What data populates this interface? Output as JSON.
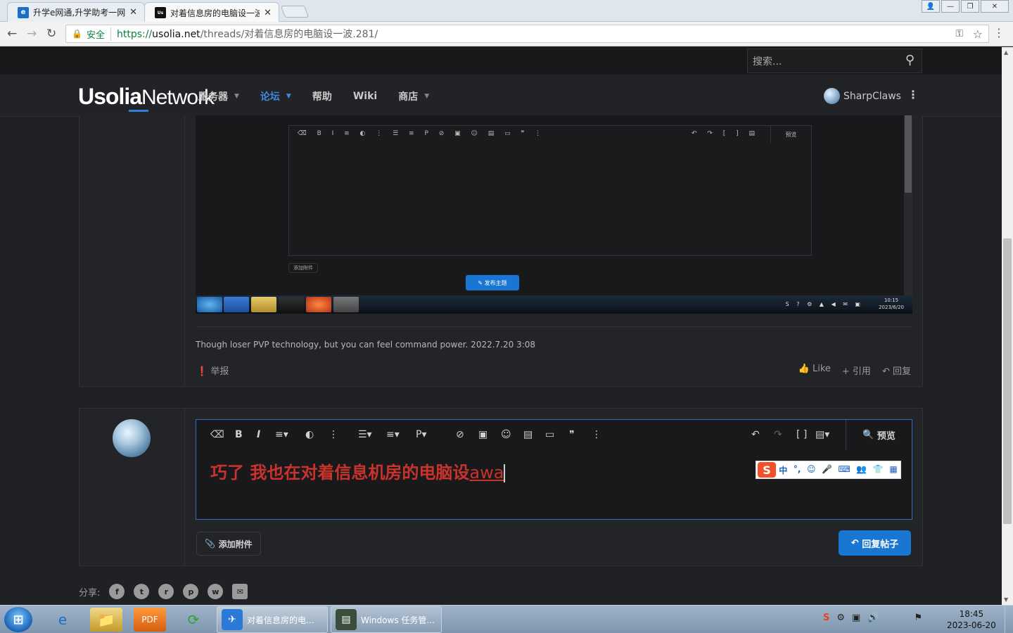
{
  "browser": {
    "tabs": [
      {
        "title": "升学e网通,升学助考一网",
        "active": false
      },
      {
        "title": "对着信息房的电脑设一波",
        "active": true
      }
    ],
    "secure_label": "安全",
    "url_prefix": "https://",
    "url_host": "usolia.net",
    "url_path": "/threads/对着信息房的电脑设一波.281/"
  },
  "site": {
    "search_placeholder": "搜索...",
    "logo_bold": "Usolia",
    "logo_light": "Network",
    "nav": [
      {
        "label": "服务器",
        "caret": true,
        "active": false
      },
      {
        "label": "论坛",
        "caret": true,
        "active": true
      },
      {
        "label": "帮助",
        "caret": false,
        "active": false
      },
      {
        "label": "Wiki",
        "caret": false,
        "active": false
      },
      {
        "label": "商店",
        "caret": true,
        "active": false
      }
    ],
    "username": "SharpClaws"
  },
  "post": {
    "embedded_screenshot": {
      "attach_label": "添加附件",
      "post_button": "发布主题",
      "preview_label": "预览",
      "time": "10:15",
      "date": "2023/6/20"
    },
    "signature": "Though loser PVP technology, but you can feel command power. 2022.7.20 3:08",
    "report_label": "举报",
    "like_label": "Like",
    "quote_label": "+ 引用",
    "reply_label": "回复"
  },
  "reply_editor": {
    "preview_label": "预览",
    "typed_text": "巧了 我也在对着信息机房的电脑设",
    "typed_text_tail": "awa",
    "ime_chars": [
      "中",
      "°,",
      "☺",
      "🎤",
      "⌨",
      "👥",
      "👕",
      "▦"
    ],
    "attach_label": "添加附件",
    "submit_label": "回复帖子"
  },
  "share": {
    "label": "分享:",
    "icons": [
      "facebook-icon",
      "twitter-icon",
      "reddit-icon",
      "pinterest-icon",
      "whatsapp-icon",
      "email-icon"
    ]
  },
  "taskbar": {
    "tasks": [
      {
        "label": "对着信息房的电...",
        "active": true
      },
      {
        "label": "Windows 任务管...",
        "active": false
      }
    ],
    "time": "18:45",
    "date": "2023-06-20"
  }
}
